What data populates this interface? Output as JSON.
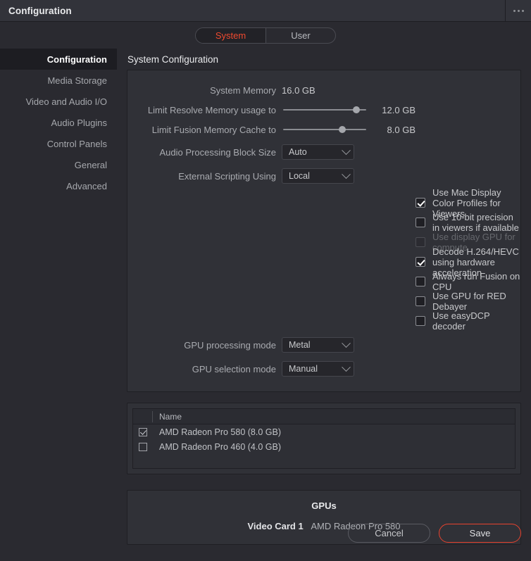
{
  "window": {
    "title": "Configuration",
    "menu_icon": "ellipsis-icon"
  },
  "tabs": [
    {
      "label": "System",
      "active": true
    },
    {
      "label": "User",
      "active": false
    }
  ],
  "sidebar": {
    "items": [
      {
        "label": "Configuration",
        "active": true
      },
      {
        "label": "Media Storage",
        "active": false
      },
      {
        "label": "Video and Audio I/O",
        "active": false
      },
      {
        "label": "Audio Plugins",
        "active": false
      },
      {
        "label": "Control Panels",
        "active": false
      },
      {
        "label": "General",
        "active": false
      },
      {
        "label": "Advanced",
        "active": false
      }
    ]
  },
  "main": {
    "heading": "System Configuration",
    "rows": {
      "system_memory": {
        "label": "System Memory",
        "value": "16.0 GB"
      },
      "limit_resolve": {
        "label": "Limit Resolve Memory usage to",
        "value": "12.0 GB",
        "percent": 92
      },
      "limit_fusion": {
        "label": "Limit Fusion Memory Cache to",
        "value": "8.0 GB",
        "percent": 73
      },
      "audio_block": {
        "label": "Audio Processing Block Size",
        "value": "Auto"
      },
      "scripting": {
        "label": "External Scripting Using",
        "value": "Local"
      },
      "gpu_processing": {
        "label": "GPU processing mode",
        "value": "Metal"
      },
      "gpu_selection": {
        "label": "GPU selection mode",
        "value": "Manual"
      }
    },
    "checkboxes": [
      {
        "label": "Use Mac Display Color Profiles for Viewers",
        "checked": true,
        "disabled": false
      },
      {
        "label": "Use 10-bit precision in viewers if available",
        "checked": false,
        "disabled": false
      },
      {
        "label": "Use display GPU for compute",
        "checked": false,
        "disabled": true
      },
      {
        "label": "Decode H.264/HEVC using hardware acceleration",
        "checked": true,
        "disabled": false
      },
      {
        "label": "Always run Fusion on CPU",
        "checked": false,
        "disabled": false
      },
      {
        "label": "Use GPU for RED Debayer",
        "checked": false,
        "disabled": false
      },
      {
        "label": "Use easyDCP decoder",
        "checked": false,
        "disabled": false
      }
    ]
  },
  "gpu_table": {
    "columns": [
      "",
      "Name"
    ],
    "rows": [
      {
        "checked": true,
        "name": "AMD Radeon Pro 580 (8.0 GB)"
      },
      {
        "checked": false,
        "name": "AMD Radeon Pro 460 (4.0 GB)"
      }
    ]
  },
  "gpu_info": {
    "title": "GPUs",
    "entries": [
      {
        "key": "Video Card 1",
        "value": "AMD Radeon Pro 580"
      }
    ]
  },
  "footer": {
    "cancel_label": "Cancel",
    "save_label": "Save"
  },
  "colors": {
    "accent": "#f04a2f",
    "save_border": "#e8432f",
    "page_bg": "#2a2a30",
    "panel_bg": "#303137",
    "titlebar_bg": "#32333a"
  }
}
